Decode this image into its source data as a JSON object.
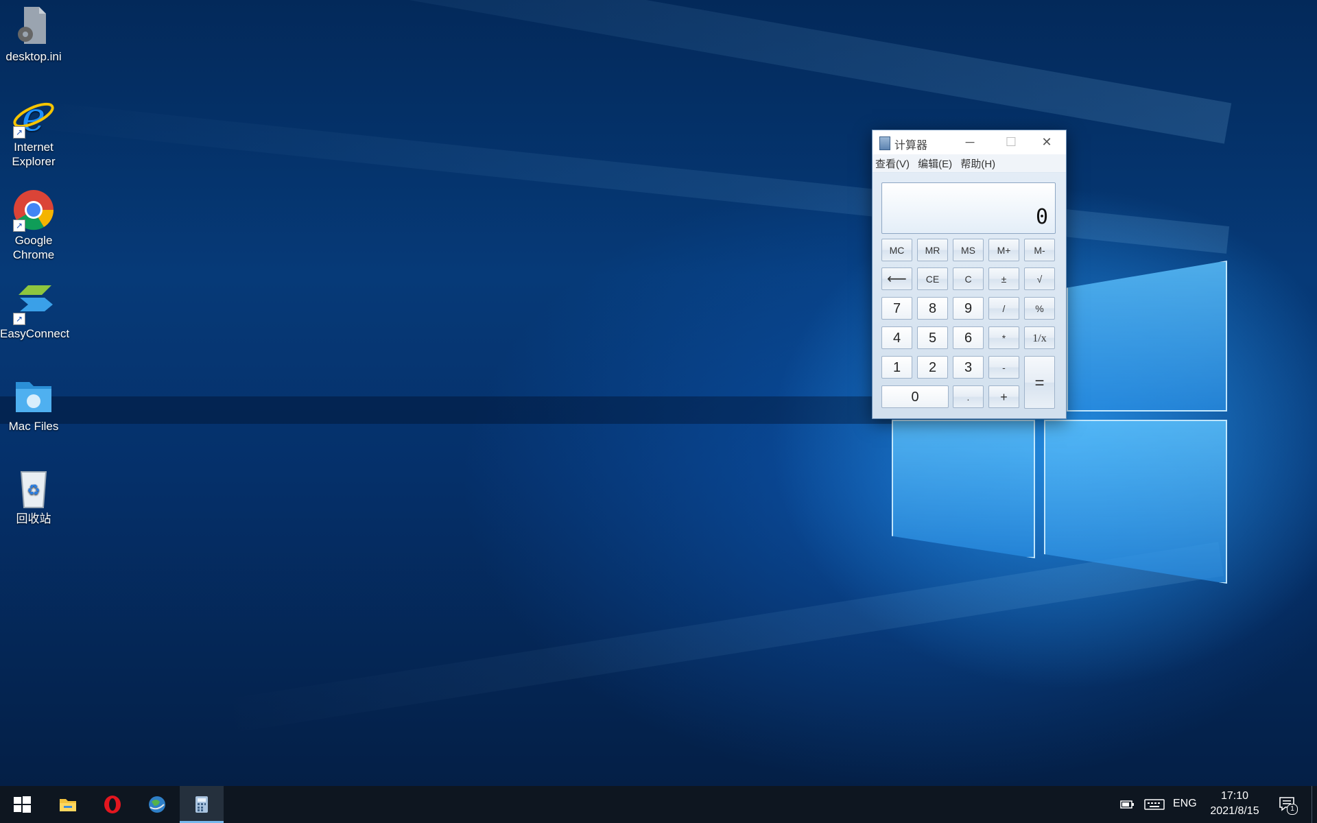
{
  "desktop": {
    "icons": [
      {
        "label": "desktop.ini",
        "icon": "ini-file-icon"
      },
      {
        "label": "Internet Explorer",
        "icon": "internet-explorer-icon"
      },
      {
        "label": "Google Chrome",
        "icon": "chrome-icon"
      },
      {
        "label": "EasyConnect",
        "icon": "easyconnect-icon"
      },
      {
        "label": "Mac Files",
        "icon": "mac-folder-icon"
      },
      {
        "label": "回收站",
        "icon": "recycle-bin-icon"
      }
    ]
  },
  "calculator": {
    "title": "计算器",
    "minimize": "─",
    "maximize": "☐",
    "close": "✕",
    "menu": [
      "查看(V)",
      "编辑(E)",
      "帮助(H)"
    ],
    "display": "0",
    "keys": {
      "mc": "MC",
      "mr": "MR",
      "ms": "MS",
      "mplus": "M+",
      "mminus": "M-",
      "back": "⟵",
      "ce": "CE",
      "c": "C",
      "plusminus": "±",
      "sqrt": "√",
      "n7": "7",
      "n8": "8",
      "n9": "9",
      "div": "/",
      "pct": "%",
      "n4": "4",
      "n5": "5",
      "n6": "6",
      "mul": "*",
      "recip": "1/x",
      "n1": "1",
      "n2": "2",
      "n3": "3",
      "sub": "-",
      "eq": "=",
      "n0": "0",
      "dot": ".",
      "add": "+"
    }
  },
  "taskbar": {
    "apps": [
      "start-icon",
      "file-explorer-icon",
      "opera-icon",
      "globe-app-icon",
      "calculator-icon"
    ],
    "active_app": "calculator-icon",
    "language": "ENG",
    "time": "17:10",
    "date": "2021/8/15",
    "notification_count": "1",
    "accent": "#76b9ed"
  }
}
